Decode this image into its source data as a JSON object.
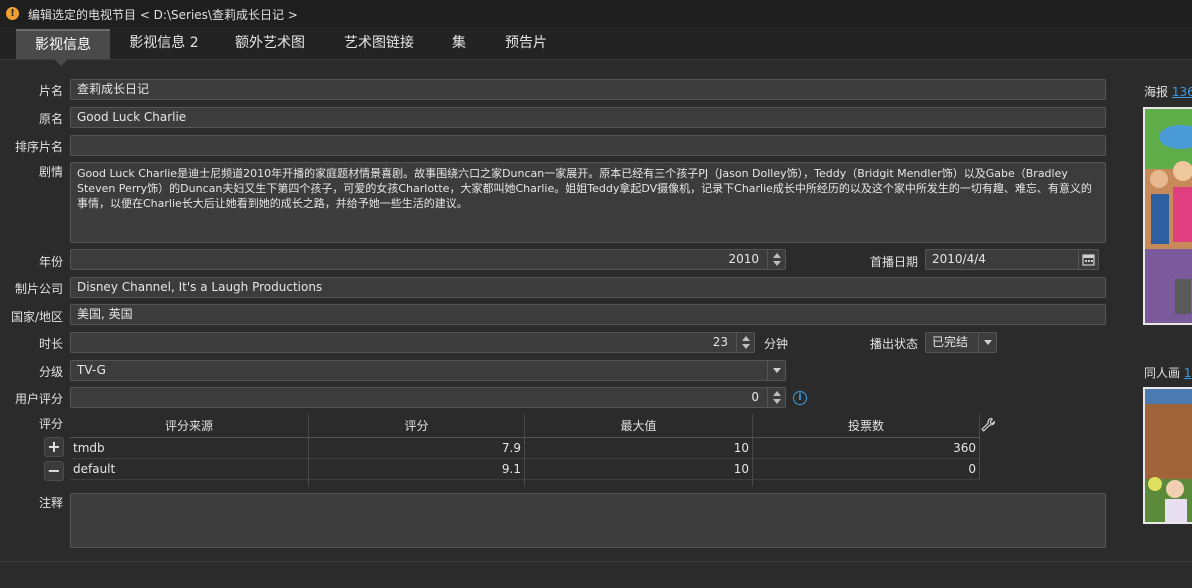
{
  "window": {
    "title": "编辑选定的电视节目 < D:\\Series\\查莉成长日记 >"
  },
  "tabs": [
    {
      "label": "影视信息"
    },
    {
      "label": "影视信息 2"
    },
    {
      "label": "额外艺术图"
    },
    {
      "label": "艺术图链接"
    },
    {
      "label": "集"
    },
    {
      "label": "预告片"
    }
  ],
  "form": {
    "title_label": "片名",
    "title_value": "查莉成长日记",
    "original_label": "原名",
    "original_value": "Good Luck Charlie",
    "sorttitle_label": "排序片名",
    "sorttitle_value": "",
    "plot_label": "剧情",
    "plot_value": "Good Luck Charlie是迪士尼频道2010年开播的家庭题材情景喜剧。故事围绕六口之家Duncan一家展开。原本已经有三个孩子PJ（Jason Dolley饰），Teddy（Bridgit Mendler饰）以及Gabe（Bradley Steven Perry饰）的Duncan夫妇又生下第四个孩子，可爱的女孩Charlotte，大家都叫她Charlie。姐姐Teddy拿起DV摄像机，记录下Charlie成长中所经历的以及这个家中所发生的一切有趣、难忘、有意义的事情，以便在Charlie长大后让她看到她的成长之路，并给予她一些生活的建议。",
    "year_label": "年份",
    "year_value": "2010",
    "premiered_label": "首播日期",
    "premiered_value": "2010/4/4",
    "studio_label": "制片公司",
    "studio_value": "Disney Channel, It's a Laugh Productions",
    "country_label": "国家/地区",
    "country_value": "美国, 英国",
    "runtime_label": "时长",
    "runtime_value": "23",
    "runtime_unit": "分钟",
    "status_label": "播出状态",
    "status_value": "已完结",
    "cert_label": "分级",
    "cert_value": "TV-G",
    "userrating_label": "用户评分",
    "userrating_value": "0",
    "ratings_label": "评分",
    "notes_label": "注释",
    "notes_value": ""
  },
  "ratings_table": {
    "headers": [
      "评分来源",
      "评分",
      "最大值",
      "投票数"
    ],
    "rows": [
      {
        "source": "tmdb",
        "rating": "7.9",
        "max": "10",
        "votes": "360"
      },
      {
        "source": "default",
        "rating": "9.1",
        "max": "10",
        "votes": "0"
      }
    ],
    "add_symbol": "+",
    "remove_symbol": "−"
  },
  "artwork": {
    "poster_label": "海报",
    "poster_link": "136",
    "fanart_label": "同人画",
    "fanart_link": "1"
  },
  "icons": {
    "app": "warning-app-icon",
    "calendar": "calendar-icon",
    "info": "info-icon",
    "wrench": "wrench-icon"
  },
  "colors": {
    "background": "#2b2b2b",
    "field": "#3c3c3c",
    "tab_active": "#4a4a4a",
    "link": "#3b9be0",
    "app_icon": "#f0a030"
  }
}
